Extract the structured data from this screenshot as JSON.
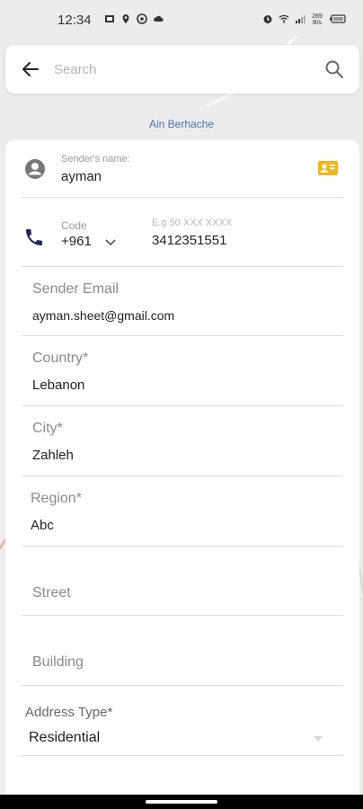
{
  "status_bar": {
    "time": "12:34",
    "data_speed": "289\nB/s"
  },
  "search": {
    "placeholder": "Search"
  },
  "map": {
    "place_label": "Ain Berhache"
  },
  "sender": {
    "name_label": "Sender's name:",
    "name_value": "ayman"
  },
  "phone": {
    "code_label": "Code",
    "code_value": "+961",
    "number_hint": "E.g 50 XXX XXXX",
    "number_value": "3412351551"
  },
  "fields": {
    "email_label": "Sender Email",
    "email_value": "ayman.sheet@gmail.com",
    "country_label": "Country*",
    "country_value": "Lebanon",
    "city_label": "City*",
    "city_value": "Zahleh",
    "region_label": "Region*",
    "region_value": "Abc",
    "street_placeholder": "Street",
    "building_placeholder": "Building",
    "address_type_label": "Address Type*",
    "address_type_value": "Residential"
  },
  "colors": {
    "accent": "#f2b619",
    "phone_icon": "#1f2a5c",
    "map_label": "#4a72b0"
  },
  "icons": [
    "back-arrow-icon",
    "search-icon",
    "account-circle-icon",
    "contact-card-icon",
    "phone-icon",
    "chevron-down-icon",
    "dropdown-triangle-icon"
  ]
}
